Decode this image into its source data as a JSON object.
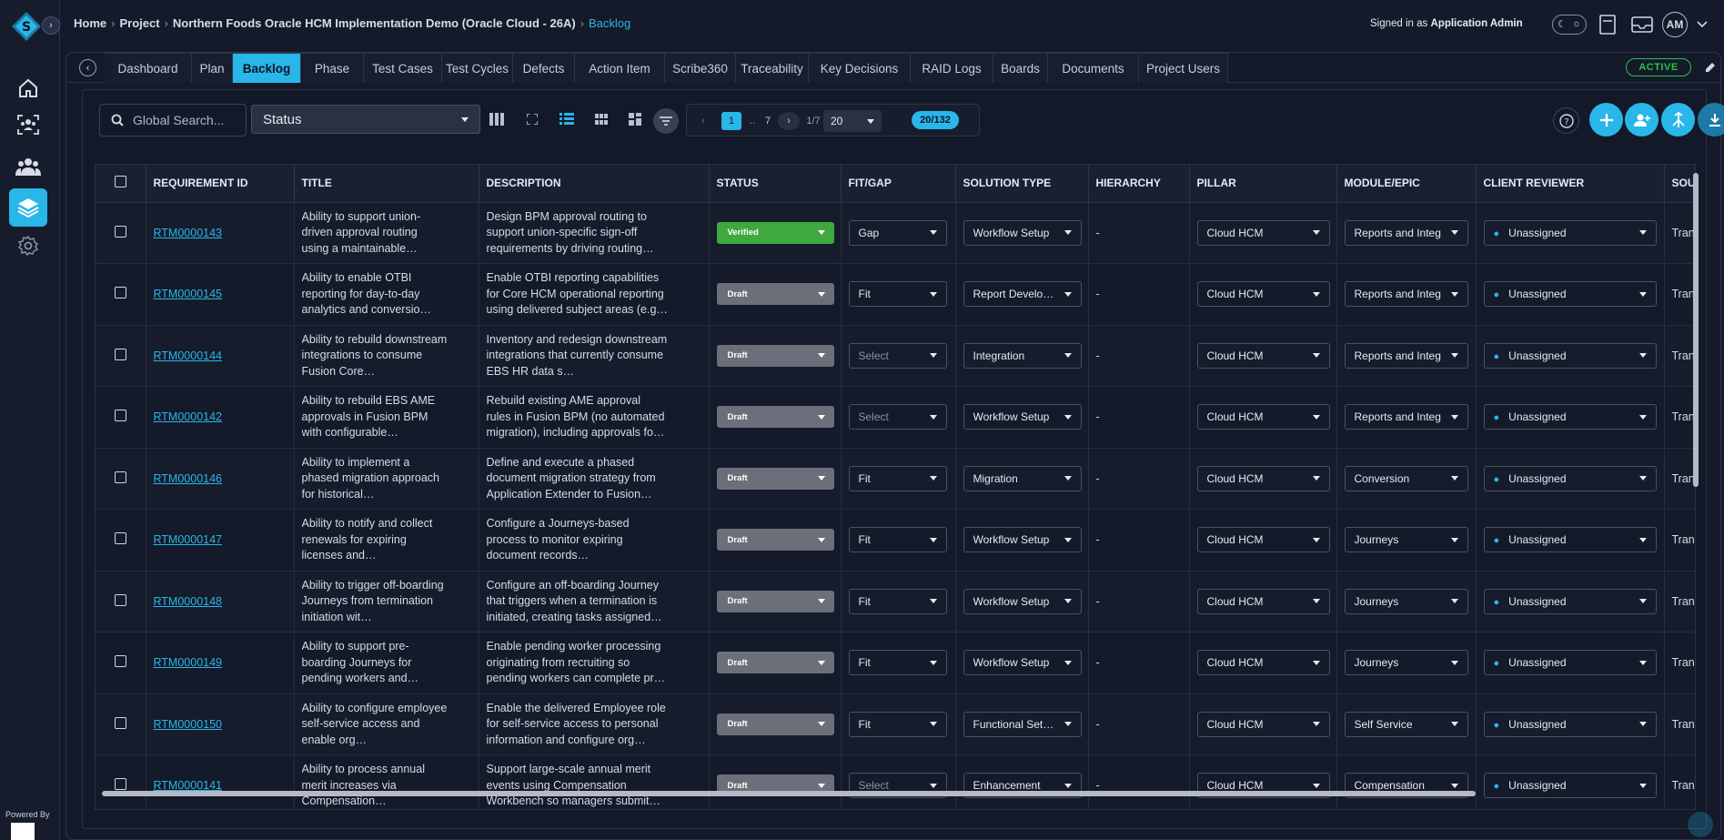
{
  "breadcrumb": {
    "home": "Home",
    "project": "Project",
    "project_name": "Northern Foods Oracle HCM Implementation Demo (Oracle Cloud - 26A)",
    "current": "Backlog"
  },
  "user": {
    "signed_in_prefix": "Signed in as",
    "name": "Application Admin",
    "initials": "AM"
  },
  "sidebar": {
    "powered_by": "Powered By",
    "items": [
      {
        "icon": "home-icon"
      },
      {
        "icon": "team-scan-icon"
      },
      {
        "icon": "users-icon"
      },
      {
        "icon": "layers-icon",
        "active": true
      },
      {
        "icon": "gear-icon"
      }
    ]
  },
  "tabs": [
    "Dashboard",
    "Plan",
    "Backlog",
    "Phase",
    "Test Cases",
    "Test Cycles",
    "Defects",
    "Action Item",
    "Scribe360",
    "Traceability",
    "Key Decisions",
    "RAID Logs",
    "Boards",
    "Documents",
    "Project Users"
  ],
  "active_tab": "Backlog",
  "project_status": "ACTIVE",
  "toolbar": {
    "search_placeholder": "Global Search...",
    "status_filter": "Status"
  },
  "pagination": {
    "current": "1",
    "ellipsis": "..",
    "last": "7",
    "page_of": "1/7",
    "page_size": "20",
    "count": "20/132"
  },
  "colors": {
    "accent": "#29b6e8",
    "verified": "#3fa83f",
    "draft": "#6a6f7a",
    "active": "#27c24c"
  },
  "table": {
    "columns": [
      "REQUIREMENT ID",
      "TITLE",
      "DESCRIPTION",
      "STATUS",
      "FIT/GAP",
      "SOLUTION TYPE",
      "HIERARCHY",
      "PILLAR",
      "MODULE/EPIC",
      "CLIENT REVIEWER",
      "SOURC"
    ],
    "rows": [
      {
        "id": "RTM0000143",
        "title": "Ability to support union-driven approval routing using a maintainable…",
        "description": "Design BPM approval routing to support union-specific sign-off requirements by driving routing…",
        "status": "Verified",
        "fit_gap": "Gap",
        "solution": "Workflow Setup",
        "hierarchy": "-",
        "pillar": "Cloud HCM",
        "module": "Reports and Integ",
        "reviewer": "Unassigned",
        "source": "Transcr"
      },
      {
        "id": "RTM0000145",
        "title": "Ability to enable OTBI reporting for day-to-day analytics and conversio…",
        "description": "Enable OTBI reporting capabilities for Core HCM operational reporting using delivered subject areas (e.g…",
        "status": "Draft",
        "fit_gap": "Fit",
        "solution": "Report Develo…",
        "hierarchy": "-",
        "pillar": "Cloud HCM",
        "module": "Reports and Integ",
        "reviewer": "Unassigned",
        "source": "Transcr"
      },
      {
        "id": "RTM0000144",
        "title": "Ability to rebuild downstream integrations to consume Fusion Core…",
        "description": "Inventory and redesign downstream integrations that currently consume EBS HR data s…",
        "status": "Draft",
        "fit_gap": "Select",
        "solution": "Integration",
        "hierarchy": "-",
        "pillar": "Cloud HCM",
        "module": "Reports and Integ",
        "reviewer": "Unassigned",
        "source": "Transcr"
      },
      {
        "id": "RTM0000142",
        "title": "Ability to rebuild EBS AME approvals in Fusion BPM with configurable…",
        "description": "Rebuild existing AME approval rules in Fusion BPM (no automated migration), including approvals fo…",
        "status": "Draft",
        "fit_gap": "Select",
        "solution": "Workflow Setup",
        "hierarchy": "-",
        "pillar": "Cloud HCM",
        "module": "Reports and Integ",
        "reviewer": "Unassigned",
        "source": "Transcr"
      },
      {
        "id": "RTM0000146",
        "title": "Ability to implement a phased migration approach for historical…",
        "description": "Define and execute a phased document migration strategy from Application Extender to Fusion…",
        "status": "Draft",
        "fit_gap": "Fit",
        "solution": "Migration",
        "hierarchy": "-",
        "pillar": "Cloud HCM",
        "module": "Conversion",
        "reviewer": "Unassigned",
        "source": "Transcr"
      },
      {
        "id": "RTM0000147",
        "title": "Ability to notify and collect renewals for expiring licenses and…",
        "description": "Configure a Journeys-based process to monitor expiring document records…",
        "status": "Draft",
        "fit_gap": "Fit",
        "solution": "Workflow Setup",
        "hierarchy": "-",
        "pillar": "Cloud HCM",
        "module": "Journeys",
        "reviewer": "Unassigned",
        "source": "Transcr"
      },
      {
        "id": "RTM0000148",
        "title": "Ability to trigger off-boarding Journeys from termination initiation wit…",
        "description": "Configure an off-boarding Journey that triggers when a termination is initiated, creating tasks assigned…",
        "status": "Draft",
        "fit_gap": "Fit",
        "solution": "Workflow Setup",
        "hierarchy": "-",
        "pillar": "Cloud HCM",
        "module": "Journeys",
        "reviewer": "Unassigned",
        "source": "Transcr"
      },
      {
        "id": "RTM0000149",
        "title": "Ability to support pre-boarding Journeys for pending workers and…",
        "description": "Enable pending worker processing originating from recruiting so pending workers can complete pr…",
        "status": "Draft",
        "fit_gap": "Fit",
        "solution": "Workflow Setup",
        "hierarchy": "-",
        "pillar": "Cloud HCM",
        "module": "Journeys",
        "reviewer": "Unassigned",
        "source": "Transcr"
      },
      {
        "id": "RTM0000150",
        "title": "Ability to configure employee self-service access and enable org…",
        "description": "Enable the delivered Employee role for self-service access to personal information and configure org…",
        "status": "Draft",
        "fit_gap": "Fit",
        "solution": "Functional Set…",
        "hierarchy": "-",
        "pillar": "Cloud HCM",
        "module": "Self Service",
        "reviewer": "Unassigned",
        "source": "Transcr"
      },
      {
        "id": "RTM0000141",
        "title": "Ability to process annual merit increases via Compensation…",
        "description": "Support large-scale annual merit events using Compensation Workbench so managers submit…",
        "status": "Draft",
        "fit_gap": "Select",
        "solution": "Enhancement",
        "hierarchy": "-",
        "pillar": "Cloud HCM",
        "module": "Compensation",
        "reviewer": "Unassigned",
        "source": "Transcr"
      }
    ]
  }
}
